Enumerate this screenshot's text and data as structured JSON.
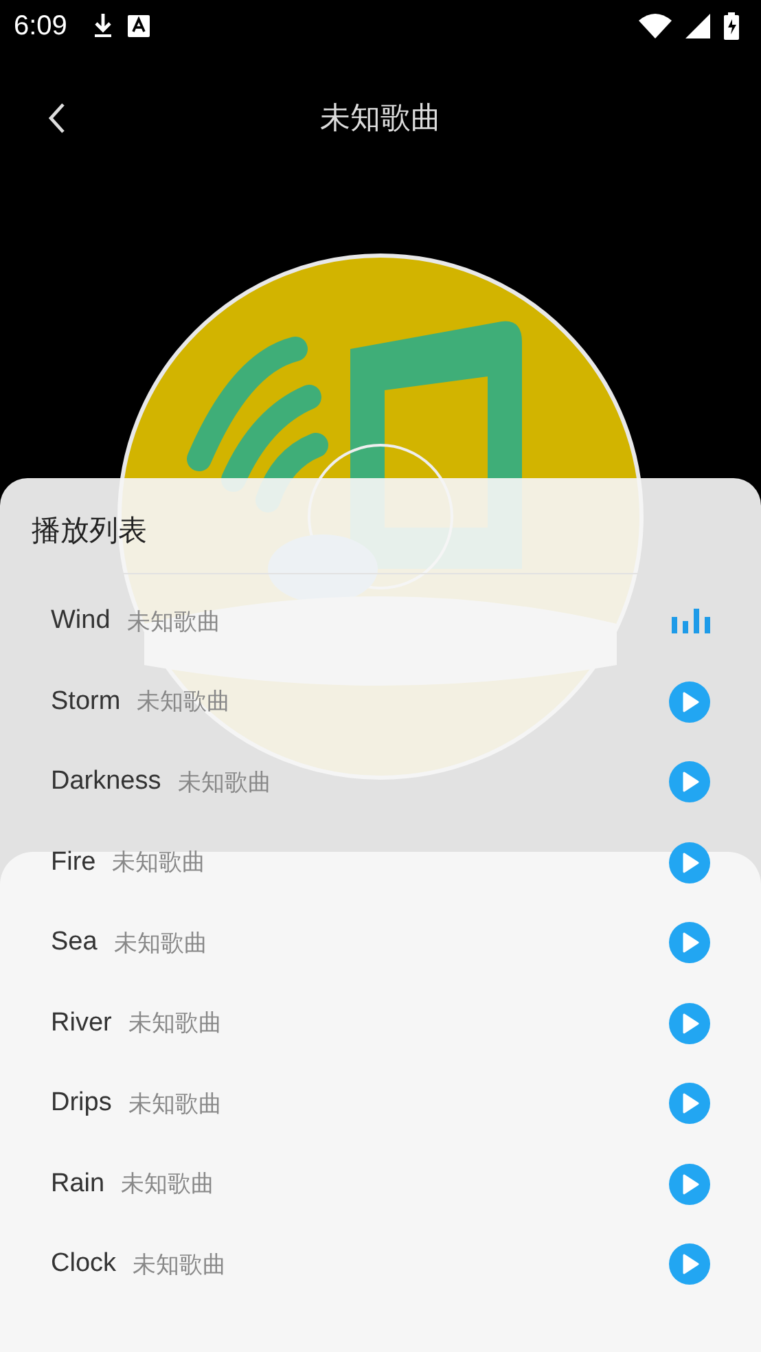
{
  "status_bar": {
    "time": "6:09"
  },
  "header": {
    "title": "未知歌曲"
  },
  "playlist": {
    "title": "播放列表",
    "items": [
      {
        "name": "Wind",
        "artist": "未知歌曲",
        "selected": true
      },
      {
        "name": "Storm",
        "artist": "未知歌曲",
        "selected": false
      },
      {
        "name": "Darkness",
        "artist": "未知歌曲",
        "selected": false
      },
      {
        "name": "Fire",
        "artist": "未知歌曲",
        "selected": false
      },
      {
        "name": "Sea",
        "artist": "未知歌曲",
        "selected": false
      },
      {
        "name": "River",
        "artist": "未知歌曲",
        "selected": false
      },
      {
        "name": "Drips",
        "artist": "未知歌曲",
        "selected": false
      },
      {
        "name": "Rain",
        "artist": "未知歌曲",
        "selected": false
      },
      {
        "name": "Clock",
        "artist": "未知歌曲",
        "selected": false
      }
    ]
  }
}
